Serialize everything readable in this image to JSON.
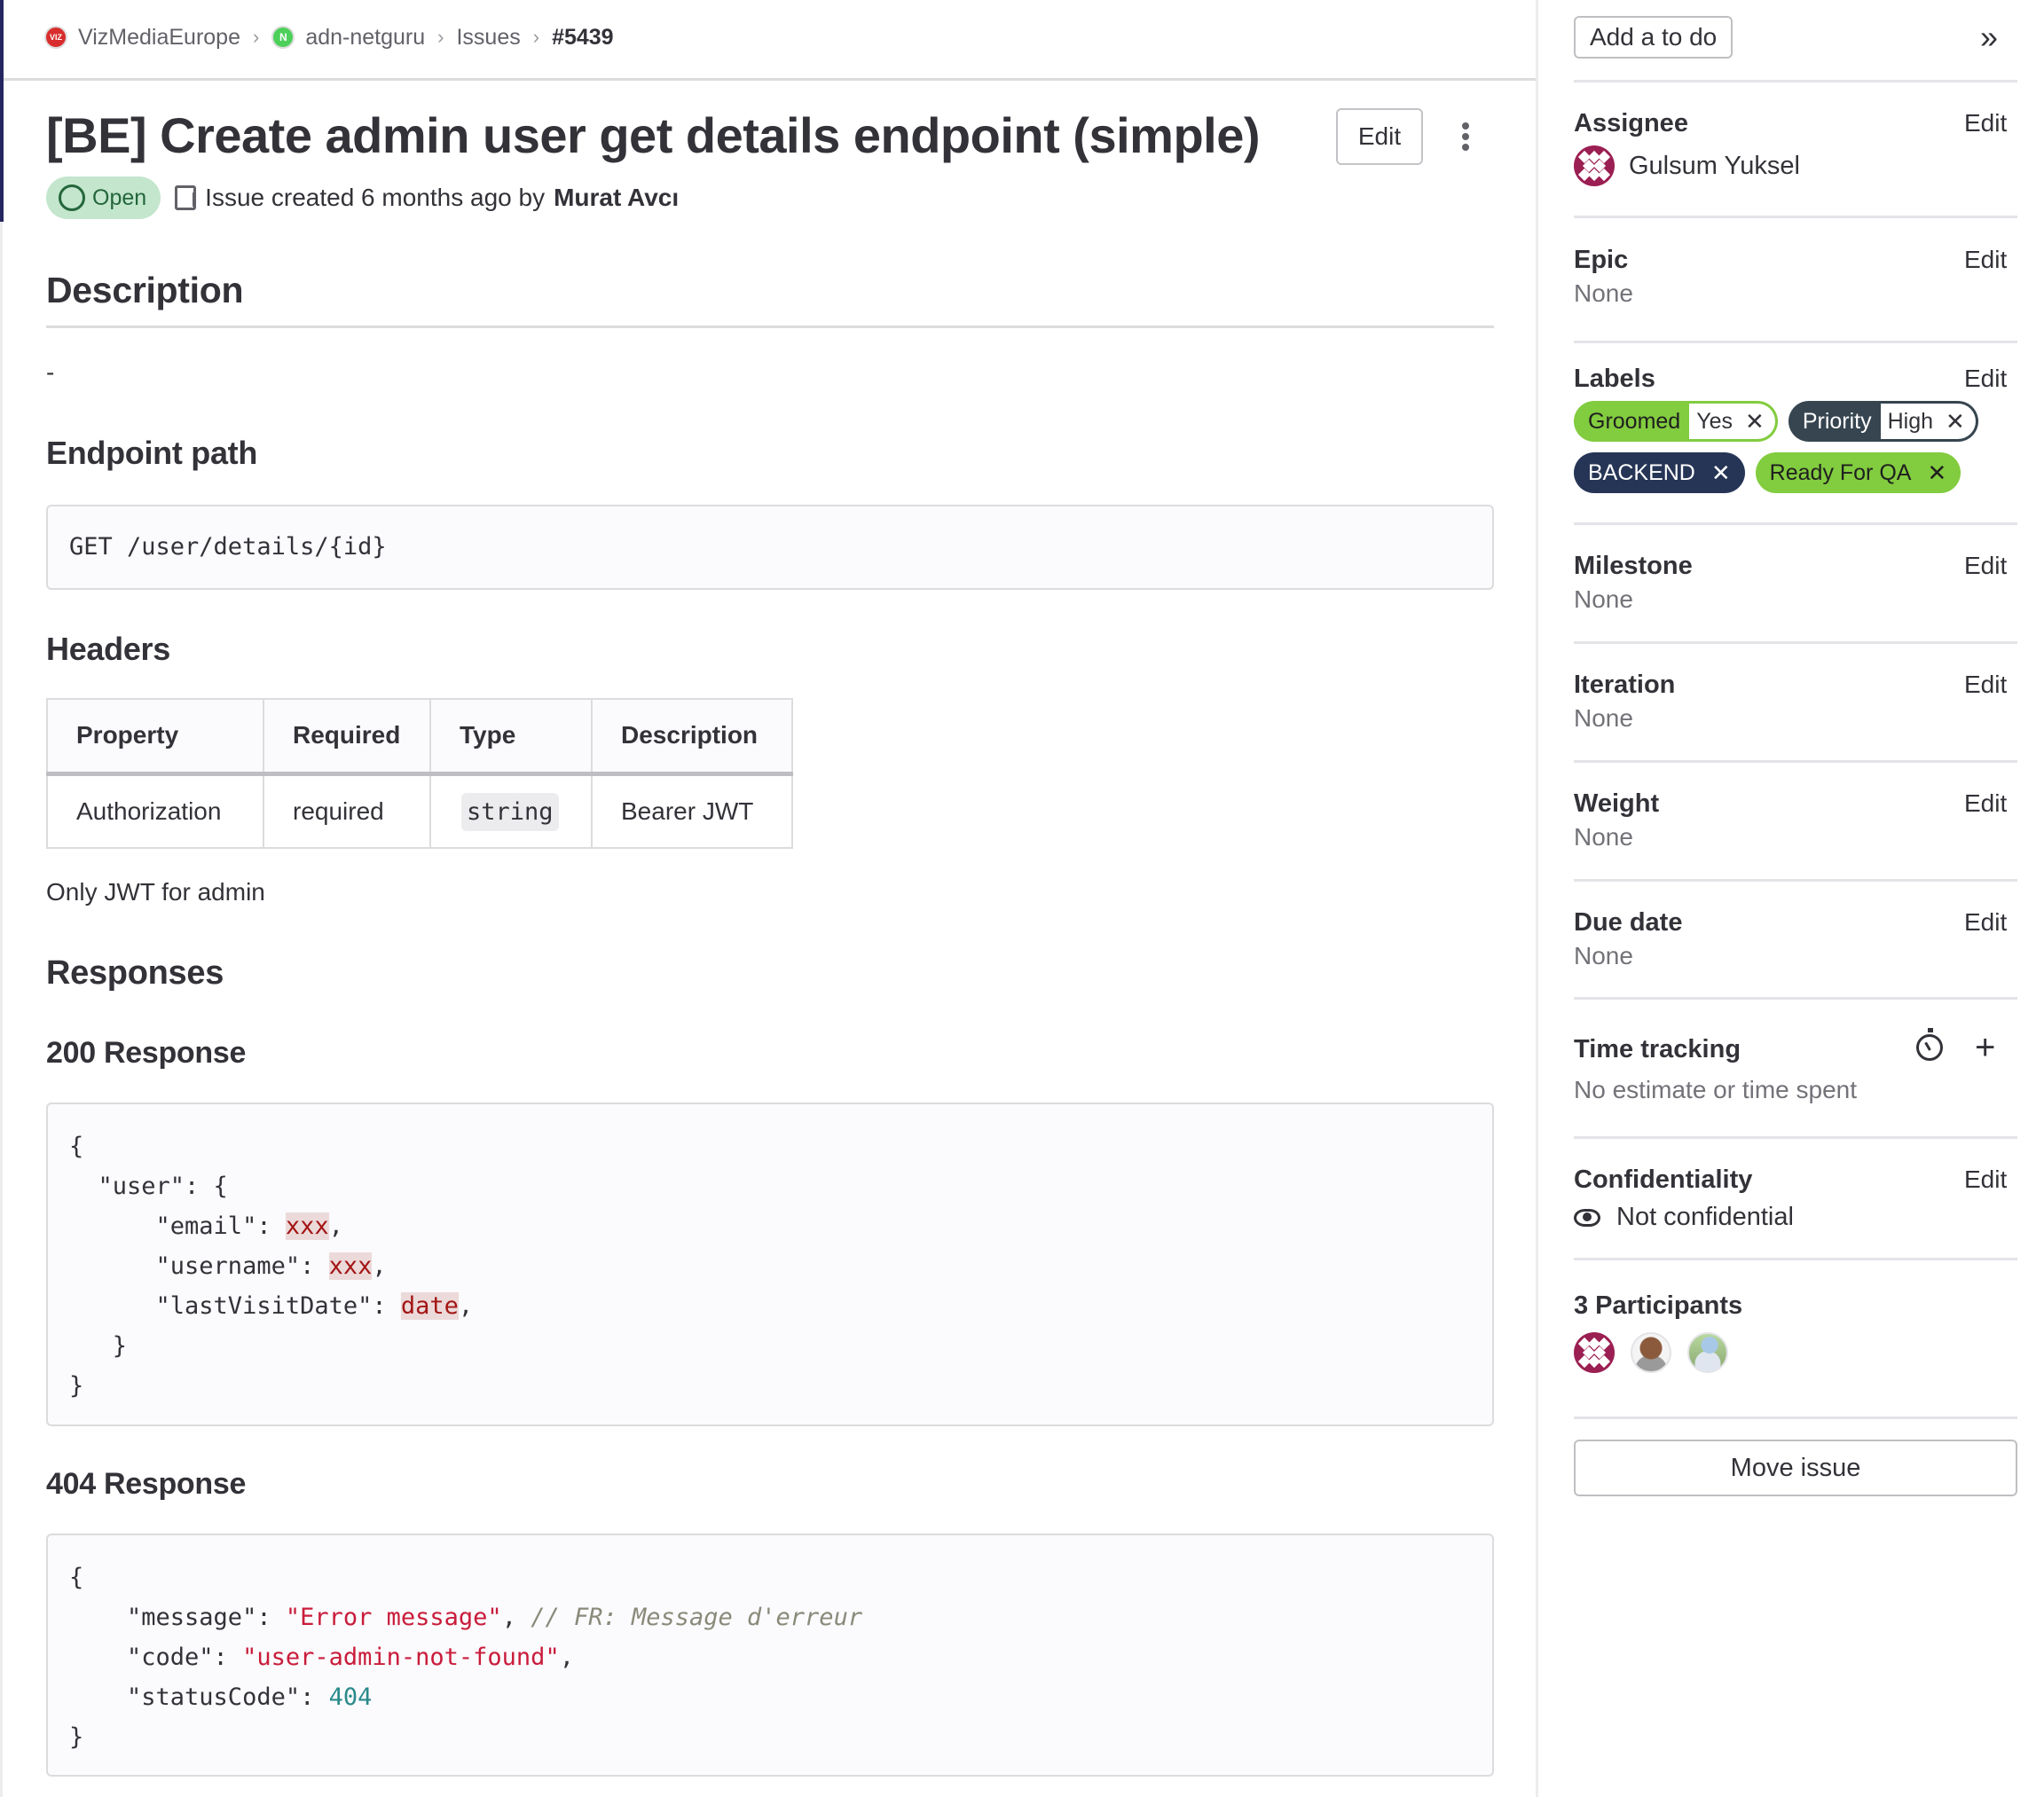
{
  "breadcrumb": {
    "items": [
      {
        "label": "VizMediaEurope",
        "avatar": "VIZ"
      },
      {
        "label": "adn-netguru",
        "avatar": "N"
      },
      {
        "label": "Issues"
      },
      {
        "label": "#5439"
      }
    ],
    "separator": "›"
  },
  "issue": {
    "title": "[BE] Create admin user get details endpoint (simple)",
    "edit_label": "Edit",
    "status": "Open",
    "meta_prefix": "Issue created 6 months ago by",
    "author": "Murat Avcı"
  },
  "description": {
    "heading": "Description",
    "dash": "-",
    "endpoint_heading": "Endpoint path",
    "endpoint": "GET /user/details/{id}",
    "headers_heading": "Headers",
    "table": {
      "columns": [
        "Property",
        "Required",
        "Type",
        "Description"
      ],
      "rows": [
        [
          "Authorization",
          "required",
          "string",
          "Bearer JWT"
        ]
      ]
    },
    "note": "Only JWT for admin",
    "responses_heading": "Responses",
    "r200_heading": "200 Response",
    "r200_lines": [
      {
        "pre": "{"
      },
      {
        "pre": "  \"user\": {"
      },
      {
        "pre": "      \"email\": ",
        "val": "xxx",
        "post": ","
      },
      {
        "pre": "      \"username\": ",
        "val": "xxx",
        "post": ","
      },
      {
        "pre": "      \"lastVisitDate\": ",
        "val": "date",
        "post": ","
      },
      {
        "pre": "   }"
      },
      {
        "pre": "}"
      }
    ],
    "r404_heading": "404 Response",
    "r404_lines": [
      {
        "pre": "{"
      },
      {
        "pre": "    \"message\": ",
        "str": "\"Error message\"",
        "post": ", ",
        "comment": "// FR: Message d'erreur"
      },
      {
        "pre": "    \"code\": ",
        "str": "\"user-admin-not-found\"",
        "post": ","
      },
      {
        "pre": "    \"statusCode\": ",
        "num": "404"
      },
      {
        "pre": "}"
      }
    ]
  },
  "sidebar": {
    "todo_label": "Add a to do",
    "collapse_icon": "»",
    "edit_label": "Edit",
    "assignee": {
      "title": "Assignee",
      "name": "Gulsum Yuksel"
    },
    "epic": {
      "title": "Epic",
      "value": "None"
    },
    "labels": {
      "title": "Labels",
      "items": [
        {
          "key": "Groomed",
          "value": "Yes",
          "color": "#82cc3f",
          "text": "#1f1f1f",
          "scoped": true
        },
        {
          "key": "Priority",
          "value": "High",
          "color": "#36454f",
          "text": "#ffffff",
          "scoped": true
        },
        {
          "key": "BACKEND",
          "color": "#263556",
          "text": "#ffffff",
          "scoped": false
        },
        {
          "key": "Ready For QA",
          "color": "#82cc3f",
          "text": "#1f1f1f",
          "scoped": false
        }
      ]
    },
    "milestone": {
      "title": "Milestone",
      "value": "None"
    },
    "iteration": {
      "title": "Iteration",
      "value": "None"
    },
    "weight": {
      "title": "Weight",
      "value": "None"
    },
    "due_date": {
      "title": "Due date",
      "value": "None"
    },
    "time_tracking": {
      "title": "Time tracking",
      "value": "No estimate or time spent"
    },
    "confidentiality": {
      "title": "Confidentiality",
      "value": "Not confidential"
    },
    "participants": {
      "title": "3 Participants",
      "count": 3
    },
    "move_label": "Move issue"
  }
}
